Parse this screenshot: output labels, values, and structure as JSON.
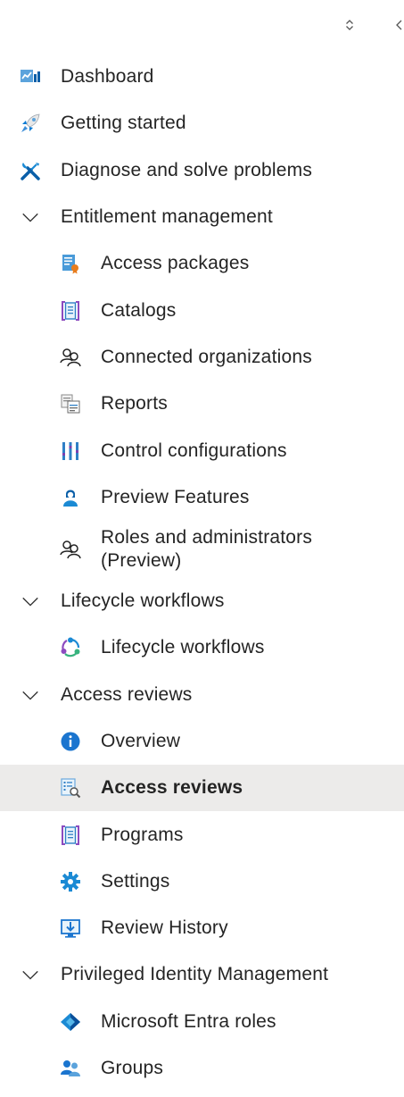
{
  "nav": {
    "dashboard": {
      "label": "Dashboard",
      "icon": "dashboard-icon"
    },
    "getting_started": {
      "label": "Getting started",
      "icon": "rocket-icon"
    },
    "diagnose": {
      "label": "Diagnose and solve problems",
      "icon": "wrench-screwdriver-icon"
    },
    "entitlement": {
      "label": "Entitlement management",
      "items": {
        "access_packages": {
          "label": "Access packages",
          "icon": "access-package-icon"
        },
        "catalogs": {
          "label": "Catalogs",
          "icon": "catalog-icon"
        },
        "connected_orgs": {
          "label": "Connected organizations",
          "icon": "people-icon"
        },
        "reports": {
          "label": "Reports",
          "icon": "reports-icon"
        },
        "control_config": {
          "label": "Control configurations",
          "icon": "control-bars-icon"
        },
        "preview_features": {
          "label": "Preview Features",
          "icon": "preview-user-icon"
        },
        "roles_admins": {
          "label_line1": "Roles and administrators",
          "label_line2": "(Preview)",
          "icon": "people-icon"
        }
      }
    },
    "lifecycle": {
      "label": "Lifecycle workflows",
      "items": {
        "lifecycle_workflows": {
          "label": "Lifecycle workflows",
          "icon": "lifecycle-icon"
        }
      }
    },
    "access_reviews": {
      "label": "Access reviews",
      "items": {
        "overview": {
          "label": "Overview",
          "icon": "info-icon"
        },
        "access_reviews": {
          "label": "Access reviews",
          "icon": "access-review-icon",
          "selected": true
        },
        "programs": {
          "label": "Programs",
          "icon": "catalog-icon"
        },
        "settings": {
          "label": "Settings",
          "icon": "gear-icon"
        },
        "review_history": {
          "label": "Review History",
          "icon": "download-history-icon"
        }
      }
    },
    "pim": {
      "label": "Privileged Identity Management",
      "items": {
        "entra_roles": {
          "label": "Microsoft Entra roles",
          "icon": "entra-diamond-icon"
        },
        "groups": {
          "label": "Groups",
          "icon": "groups-icon"
        }
      }
    }
  },
  "colors": {
    "selected_bg": "#ecebea",
    "accent_blue": "#0078d4",
    "text": "#242424"
  }
}
